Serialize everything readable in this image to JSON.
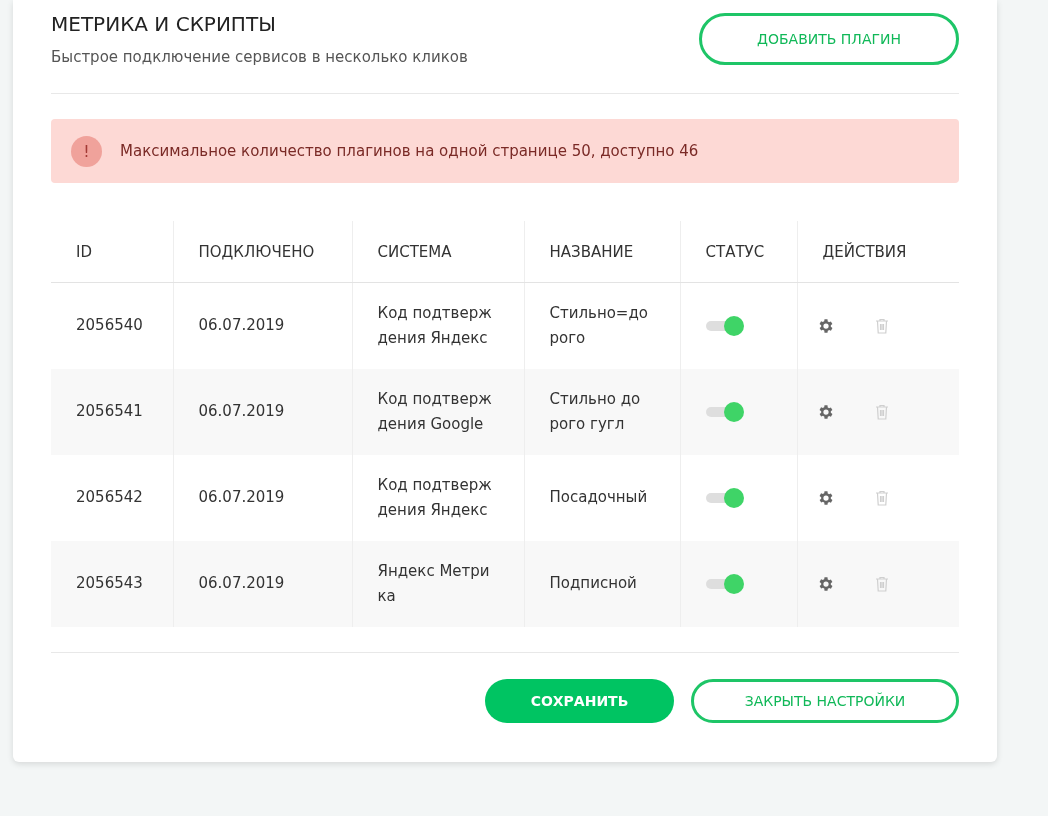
{
  "header": {
    "title": "МЕТРИКА И СКРИПТЫ",
    "subtitle": "Быстрое подключение сервисов в несколько кликов",
    "add_button": "ДОБАВИТЬ ПЛАГИН"
  },
  "alert": {
    "icon": "!",
    "text": "Максимальное количество плагинов на одной странице 50, доступно 46"
  },
  "table": {
    "columns": [
      "ID",
      "ПОДКЛЮЧЕНО",
      "СИСТЕМА",
      "НАЗВАНИЕ",
      "СТАТУС",
      "ДЕЙСТВИЯ"
    ],
    "rows": [
      {
        "id": "2056540",
        "date": "06.07.2019",
        "system": "Код подтверж\nдения Яндекс",
        "name": "Стильно=до\nрого",
        "on": true
      },
      {
        "id": "2056541",
        "date": "06.07.2019",
        "system": "Код подтверж\nдения Google",
        "name": "Стильно до\nрого гугл",
        "on": true
      },
      {
        "id": "2056542",
        "date": "06.07.2019",
        "system": "Код подтверж\nдения Яндекс",
        "name": "Посадочный",
        "on": true
      },
      {
        "id": "2056543",
        "date": "06.07.2019",
        "system": "Яндекс Метри\nка",
        "name": "Подписной",
        "on": true
      }
    ]
  },
  "footer": {
    "save_button": "СОХРАНИТЬ",
    "close_button": "ЗАКРЫТЬ НАСТРОЙКИ"
  }
}
